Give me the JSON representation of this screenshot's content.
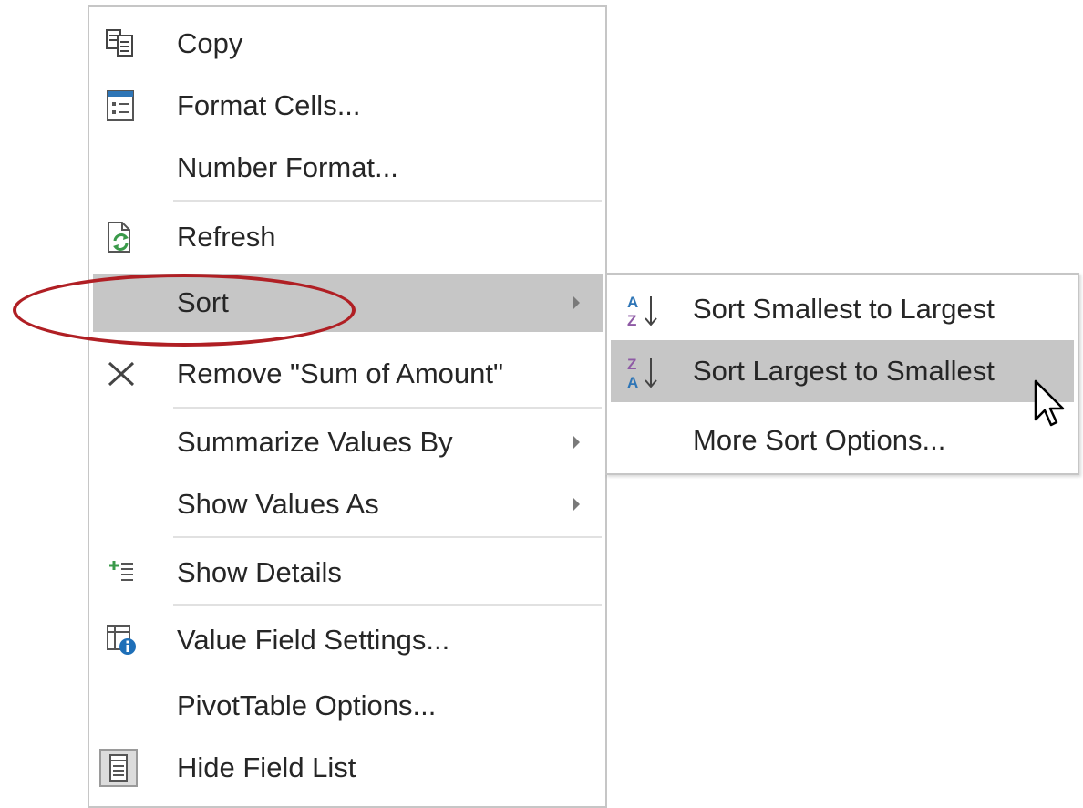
{
  "context_menu": {
    "items": [
      {
        "label": "Copy",
        "icon": "copy-icon"
      },
      {
        "label": "Format Cells...",
        "icon": "format-cells-icon"
      },
      {
        "label": "Number Format...",
        "icon": ""
      },
      {
        "label": "Refresh",
        "icon": "refresh-icon"
      },
      {
        "label": "Sort",
        "icon": "",
        "has_submenu": true,
        "highlighted": true
      },
      {
        "label": "Remove \"Sum of Amount\"",
        "icon": "remove-x-icon"
      },
      {
        "label": "Summarize Values By",
        "icon": "",
        "has_submenu": true
      },
      {
        "label": "Show Values As",
        "icon": "",
        "has_submenu": true
      },
      {
        "label": "Show Details",
        "icon": "show-details-icon"
      },
      {
        "label": "Value Field Settings...",
        "icon": "value-field-settings-icon"
      },
      {
        "label": "PivotTable Options...",
        "icon": ""
      },
      {
        "label": "Hide Field List",
        "icon": "field-list-icon"
      }
    ]
  },
  "sort_submenu": {
    "items": [
      {
        "label": "Sort Smallest to Largest",
        "icon": "sort-ascending-icon"
      },
      {
        "label": "Sort Largest to Smallest",
        "icon": "sort-descending-icon",
        "highlighted": true
      },
      {
        "label": "More Sort Options...",
        "icon": ""
      }
    ]
  },
  "colors": {
    "highlight": "#c6c6c6",
    "annotation_ellipse": "#b01f24",
    "sort_icon_blue": "#2e75b6",
    "sort_icon_purple": "#8e5aa5"
  }
}
